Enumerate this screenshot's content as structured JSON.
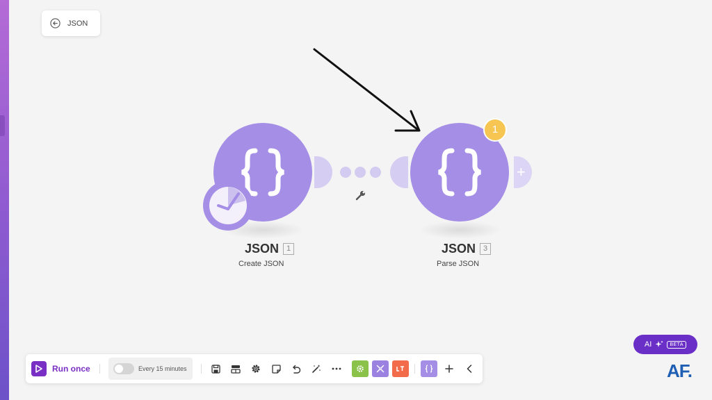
{
  "header": {
    "back_label": "JSON"
  },
  "nodes": [
    {
      "title": "JSON",
      "number": "1",
      "subtitle": "Create JSON"
    },
    {
      "title": "JSON",
      "number": "3",
      "subtitle": "Parse JSON",
      "badge_count": "1"
    }
  ],
  "toolbar": {
    "run_label": "Run once",
    "schedule_label": "Every 15 minutes"
  },
  "ai_button": {
    "label": "AI",
    "badge": "BETA"
  },
  "logo": {
    "text": "AF."
  },
  "colors": {
    "module_purple": "#a58ee6",
    "accent_purple": "#7a2fc4",
    "badge_yellow": "#f7c552",
    "tools_green": "#8bc34a",
    "flow_purple": "#9b82e0",
    "text_parser_orange": "#f26b4b",
    "logo_blue": "#1f5fb3"
  }
}
